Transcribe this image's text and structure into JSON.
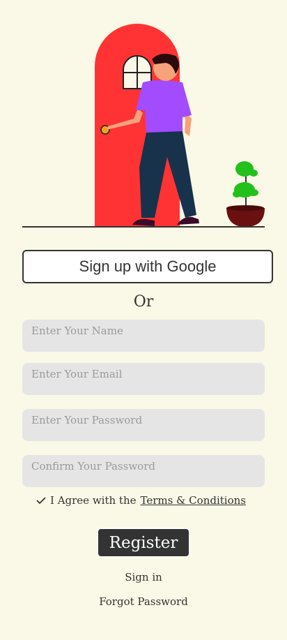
{
  "google_button": "Sign up with Google",
  "or_label": "Or",
  "fields": [
    {
      "placeholder": "Enter Your Name",
      "value": ""
    },
    {
      "placeholder": "Enter Your Email",
      "value": ""
    },
    {
      "placeholder": "Enter Your Password",
      "value": ""
    },
    {
      "placeholder": "Confirm Your Password",
      "value": ""
    }
  ],
  "agree": {
    "prefix": "I Agree with the",
    "link": "Terms & Conditions",
    "checked": true
  },
  "register_label": "Register",
  "signin_label": "Sign in",
  "forgot_label": "Forgot Password",
  "colors": {
    "background": "#faf8e7",
    "door": "#ff3434",
    "shirt": "#a24bff",
    "button": "#333333"
  }
}
